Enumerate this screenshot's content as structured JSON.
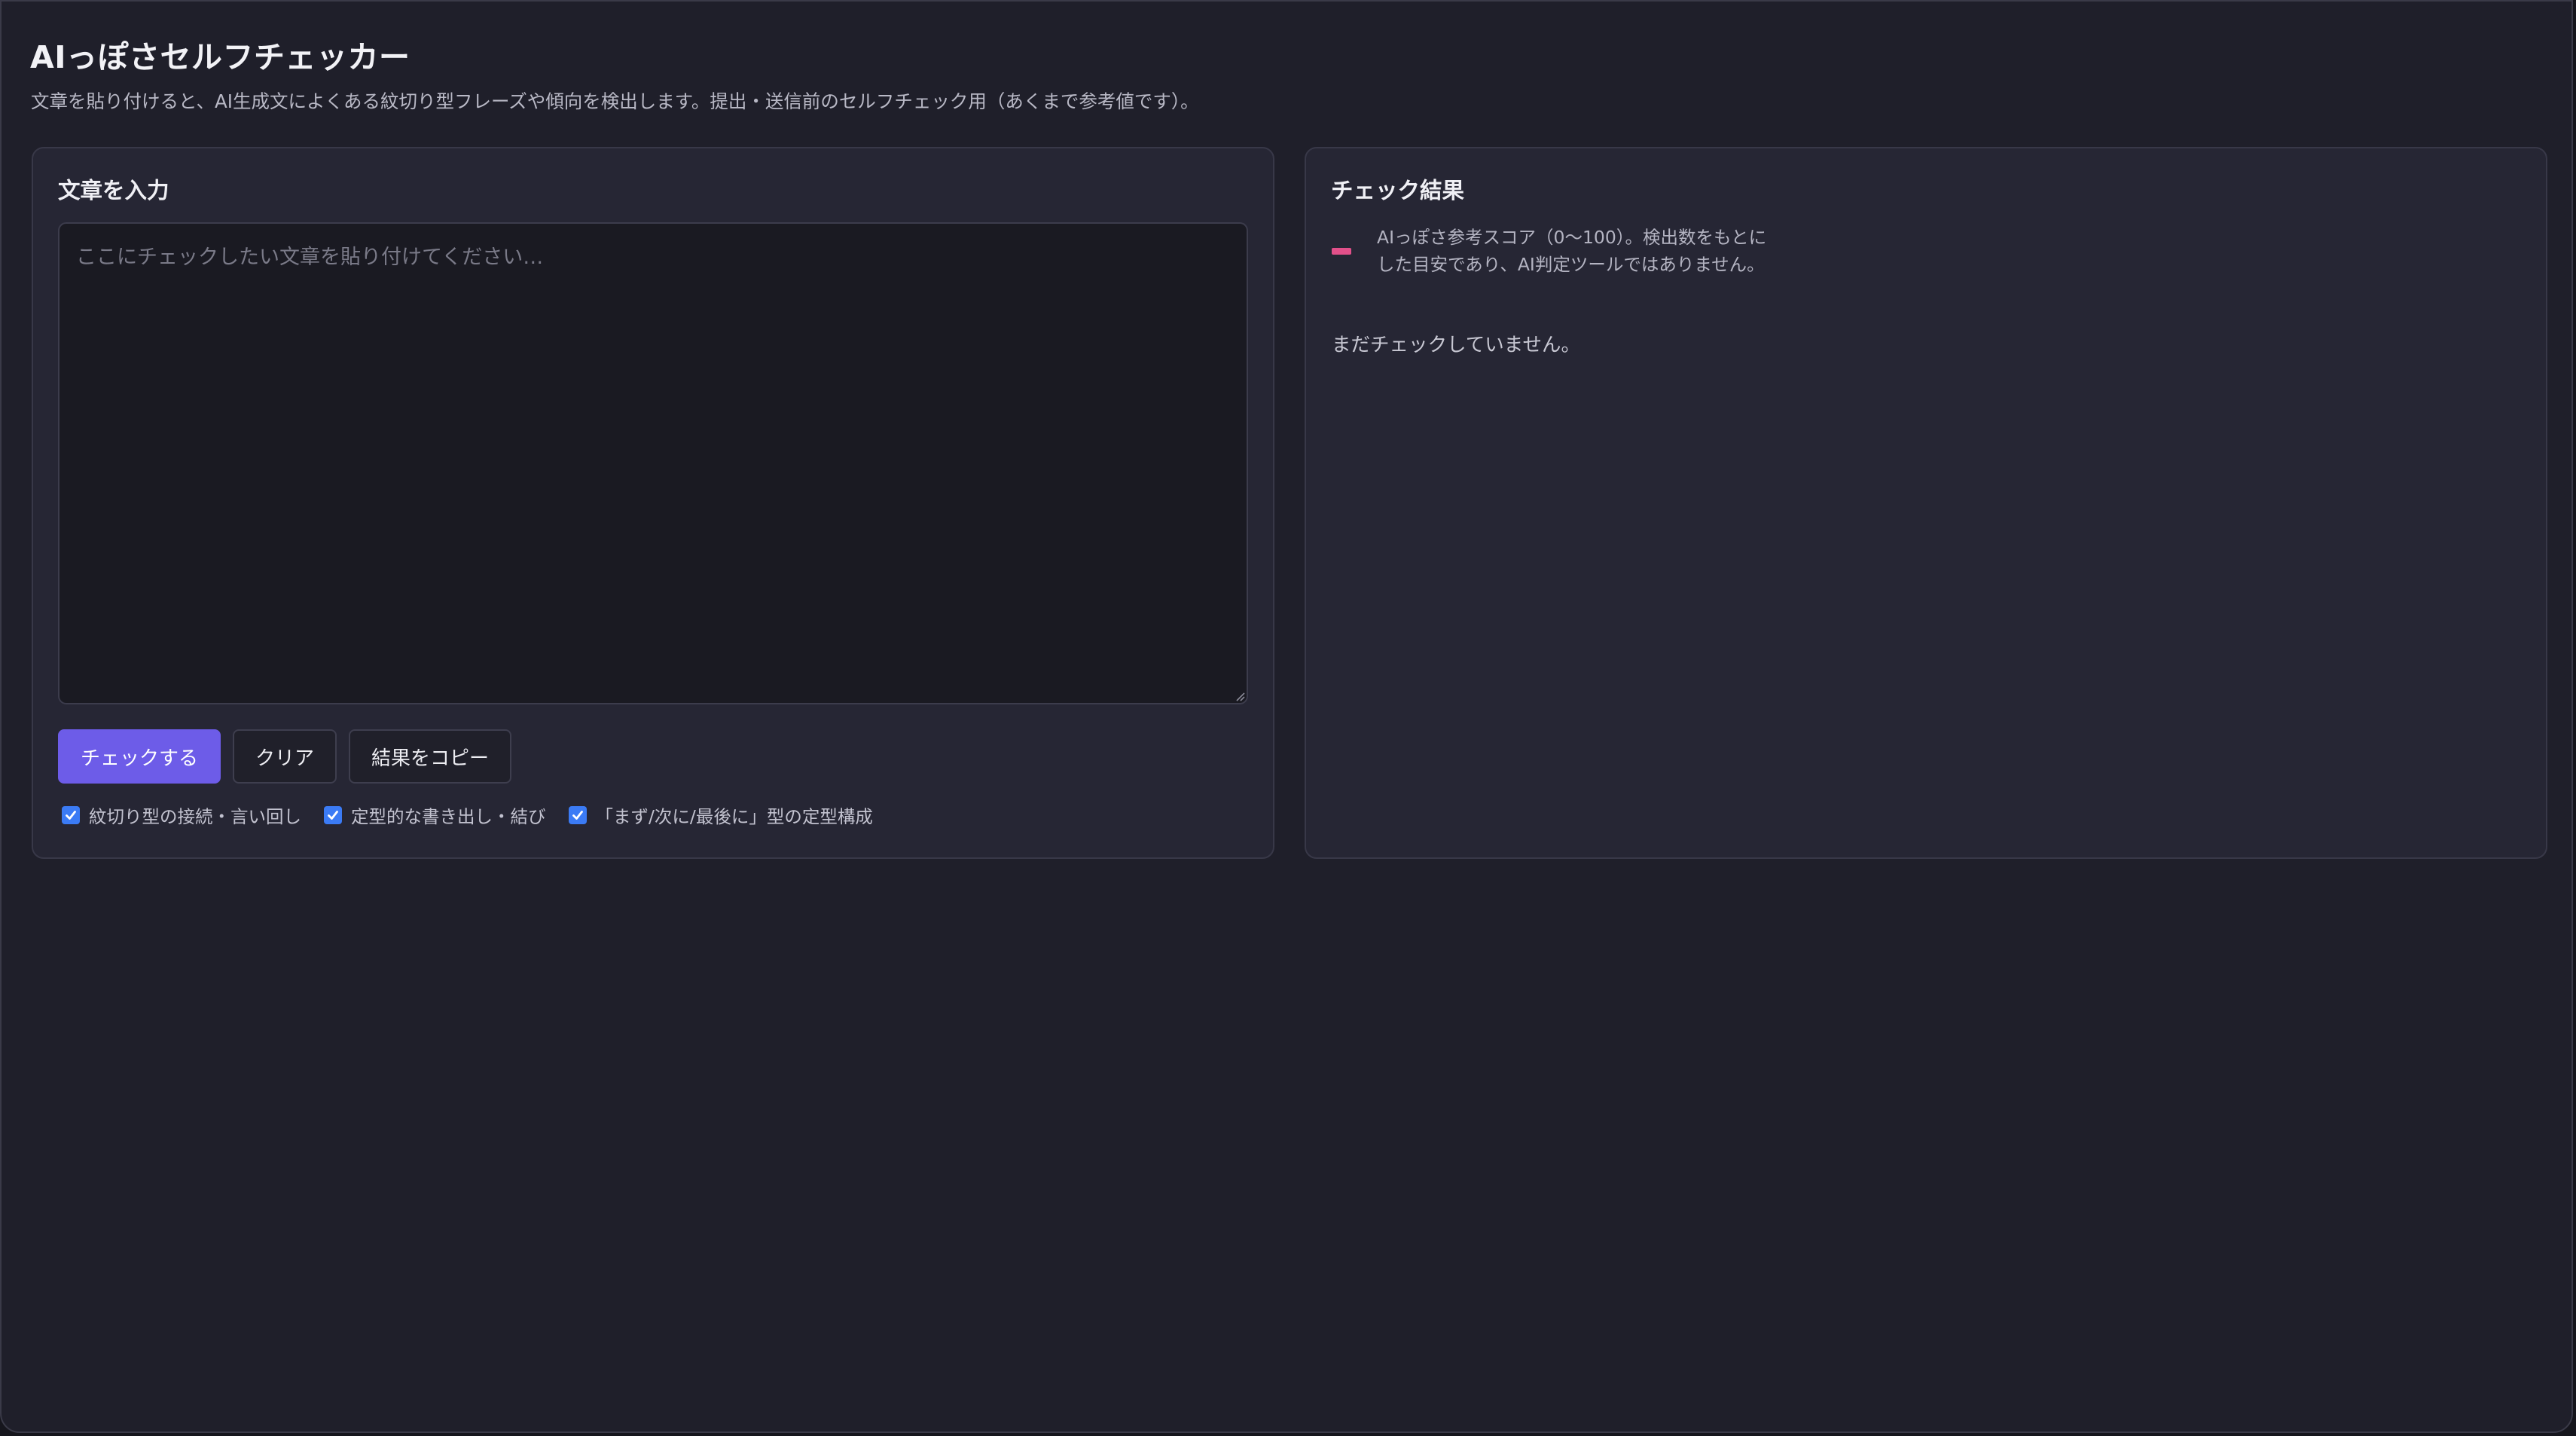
{
  "header": {
    "title": "AIっぽさセルフチェッカー",
    "description": "文章を貼り付けると、AI生成文によくある紋切り型フレーズや傾向を検出します。提出・送信前のセルフチェック用（あくまで参考値です）。"
  },
  "input_panel": {
    "heading": "文章を入力",
    "textarea_value": "",
    "textarea_placeholder": "ここにチェックしたい文章を貼り付けてください…",
    "buttons": {
      "check": "チェックする",
      "clear": "クリア",
      "copy": "結果をコピー"
    },
    "options": [
      {
        "label": "紋切り型の接続・言い回し",
        "checked": true
      },
      {
        "label": "定型的な書き出し・結び",
        "checked": true
      },
      {
        "label": "「まず/次に/最後に」型の定型構成",
        "checked": true
      }
    ]
  },
  "result_panel": {
    "heading": "チェック結果",
    "score_note": "AIっぽさ参考スコア（0〜100）。検出数をもとにした目安であり、AI判定ツールではありません。",
    "status": "まだチェックしていません。"
  },
  "colors": {
    "primary": "#6d5ce8",
    "checkbox": "#3b7bf5",
    "score_bar": "#e2508a",
    "background": "#1f1f2a",
    "card": "#262634"
  },
  "icons": {
    "checkbox_check": "checkmark-icon",
    "resize": "resize-grip-icon"
  }
}
